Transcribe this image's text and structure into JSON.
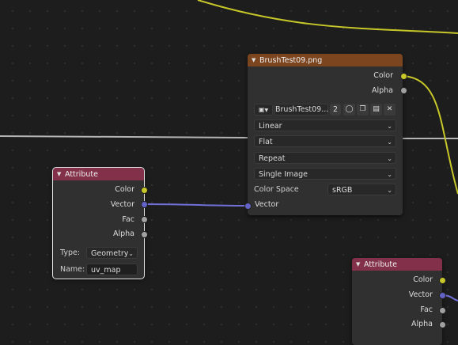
{
  "attribute_node_left": {
    "title": "Attribute",
    "outputs": [
      "Color",
      "Vector",
      "Fac",
      "Alpha"
    ],
    "type_label": "Type:",
    "type_value": "Geometry",
    "name_label": "Name:",
    "name_value": "uv_map"
  },
  "image_texture_node": {
    "title": "BrushTest09.png",
    "outputs": [
      "Color",
      "Alpha"
    ],
    "image_name": "BrushTest09...",
    "users_count": "2",
    "interpolation": "Linear",
    "projection": "Flat",
    "extension": "Repeat",
    "source": "Single Image",
    "color_space_label": "Color Space",
    "color_space_value": "sRGB",
    "input_vector": "Vector"
  },
  "attribute_node_right": {
    "title": "Attribute",
    "outputs": [
      "Color",
      "Vector",
      "Fac",
      "Alpha"
    ]
  },
  "colors": {
    "canvas_bg": "#1d1d1d",
    "node_bg": "#303030",
    "attribute_header": "#83314a",
    "texture_header": "#7b4520",
    "color_socket": "#c7c729",
    "vector_socket": "#6363c7",
    "float_socket": "#a1a1a1",
    "color_link": "#c7c729",
    "vector_link": "#6b6bd6",
    "shader_link": "#b4b4b4"
  }
}
